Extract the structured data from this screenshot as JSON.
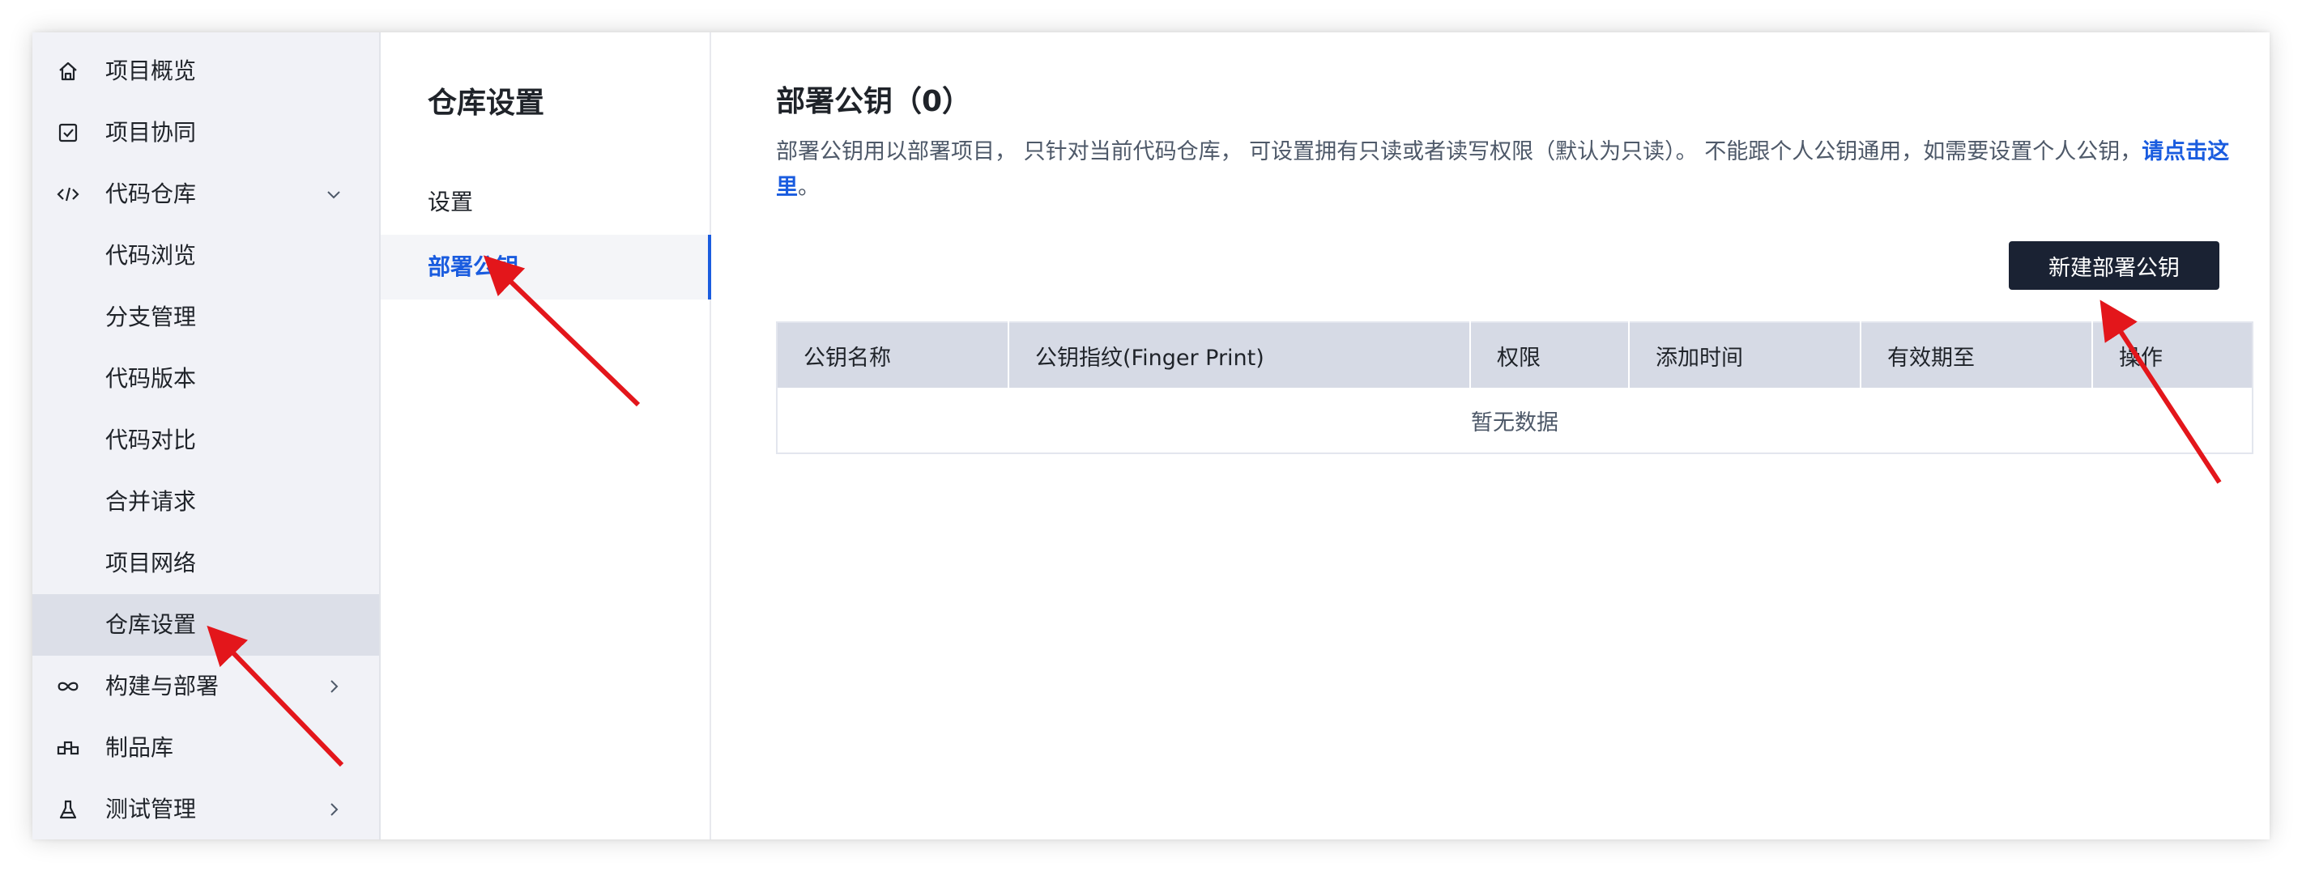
{
  "sidebar": {
    "items": [
      {
        "label": "项目概览",
        "icon": "home-icon"
      },
      {
        "label": "项目协同",
        "icon": "checkbox-icon"
      },
      {
        "label": "代码仓库",
        "icon": "code-icon",
        "chevron": "down"
      },
      {
        "label": "代码浏览"
      },
      {
        "label": "分支管理"
      },
      {
        "label": "代码版本"
      },
      {
        "label": "代码对比"
      },
      {
        "label": "合并请求"
      },
      {
        "label": "项目网络"
      },
      {
        "label": "仓库设置",
        "active": true
      },
      {
        "label": "构建与部署",
        "icon": "infinity-icon",
        "chevron": "right"
      },
      {
        "label": "制品库",
        "icon": "package-icon"
      },
      {
        "label": "测试管理",
        "icon": "flask-icon",
        "chevron": "right"
      }
    ]
  },
  "subnav": {
    "title": "仓库设置",
    "items": [
      {
        "label": "设置"
      },
      {
        "label": "部署公钥",
        "active": true
      }
    ]
  },
  "main": {
    "heading": "部署公钥（0）",
    "description": "部署公钥用以部署项目， 只针对当前代码仓库， 可设置拥有只读或者读写权限（默认为只读）。 不能跟个人公钥通用，如需要设置个人公钥，",
    "link_text": "请点击这里",
    "description_end": "。",
    "new_button": "新建部署公钥",
    "table": {
      "columns": [
        "公钥名称",
        "公钥指纹(Finger Print)",
        "权限",
        "添加时间",
        "有效期至",
        "操作"
      ],
      "empty_text": "暂无数据"
    }
  },
  "colors": {
    "accent": "#1a5cdf",
    "button_bg": "#1a2233",
    "sidebar_bg": "#f1f2f7",
    "sidebar_active_bg": "#dcdfe8",
    "table_header_bg": "#d6dae5",
    "annotation_arrow": "#e3161b"
  }
}
